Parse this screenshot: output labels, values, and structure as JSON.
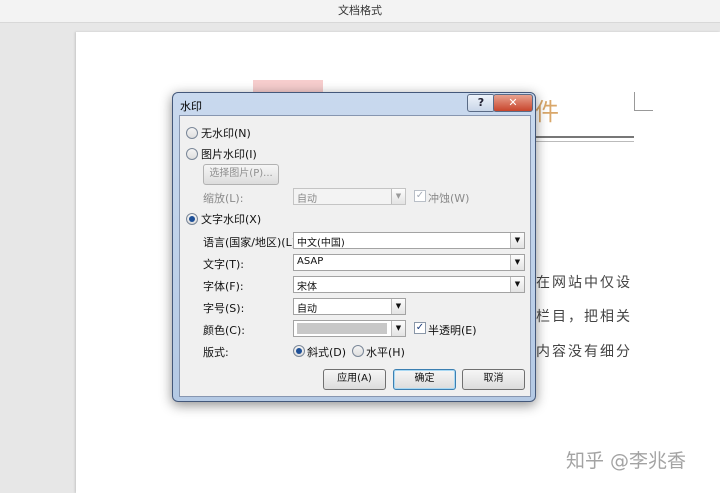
{
  "window": {
    "title": "文档格式"
  },
  "document": {
    "title_char": "件",
    "body_lines": [
      "在网站中仅设",
      "栏目，把相关",
      "内容没有细分"
    ],
    "watermark": "知乎 @李兆香"
  },
  "dialog": {
    "title": "水印",
    "help_label": "?",
    "close_label": "✕",
    "no_watermark_label": "无水印(N)",
    "picture_watermark_label": "图片水印(I)",
    "select_picture_label": "选择图片(P)...",
    "scale_label": "缩放(L):",
    "scale_value": "自动",
    "washout_label": "冲蚀(W)",
    "text_watermark_label": "文字水印(X)",
    "language_label": "语言(国家/地区)(L):",
    "language_value": "中文(中国)",
    "text_label": "文字(T):",
    "text_value": "ASAP",
    "font_label": "字体(F):",
    "font_value": "宋体",
    "size_label": "字号(S):",
    "size_value": "自动",
    "color_label": "颜色(C):",
    "semi_transparent_label": "半透明(E)",
    "layout_label": "版式:",
    "diagonal_label": "斜式(D)",
    "horizontal_label": "水平(H)",
    "apply_label": "应用(A)",
    "ok_label": "确定",
    "cancel_label": "取消",
    "selected_type": "text",
    "washout_checked": true,
    "semi_transparent_checked": true,
    "layout_selected": "diagonal"
  }
}
